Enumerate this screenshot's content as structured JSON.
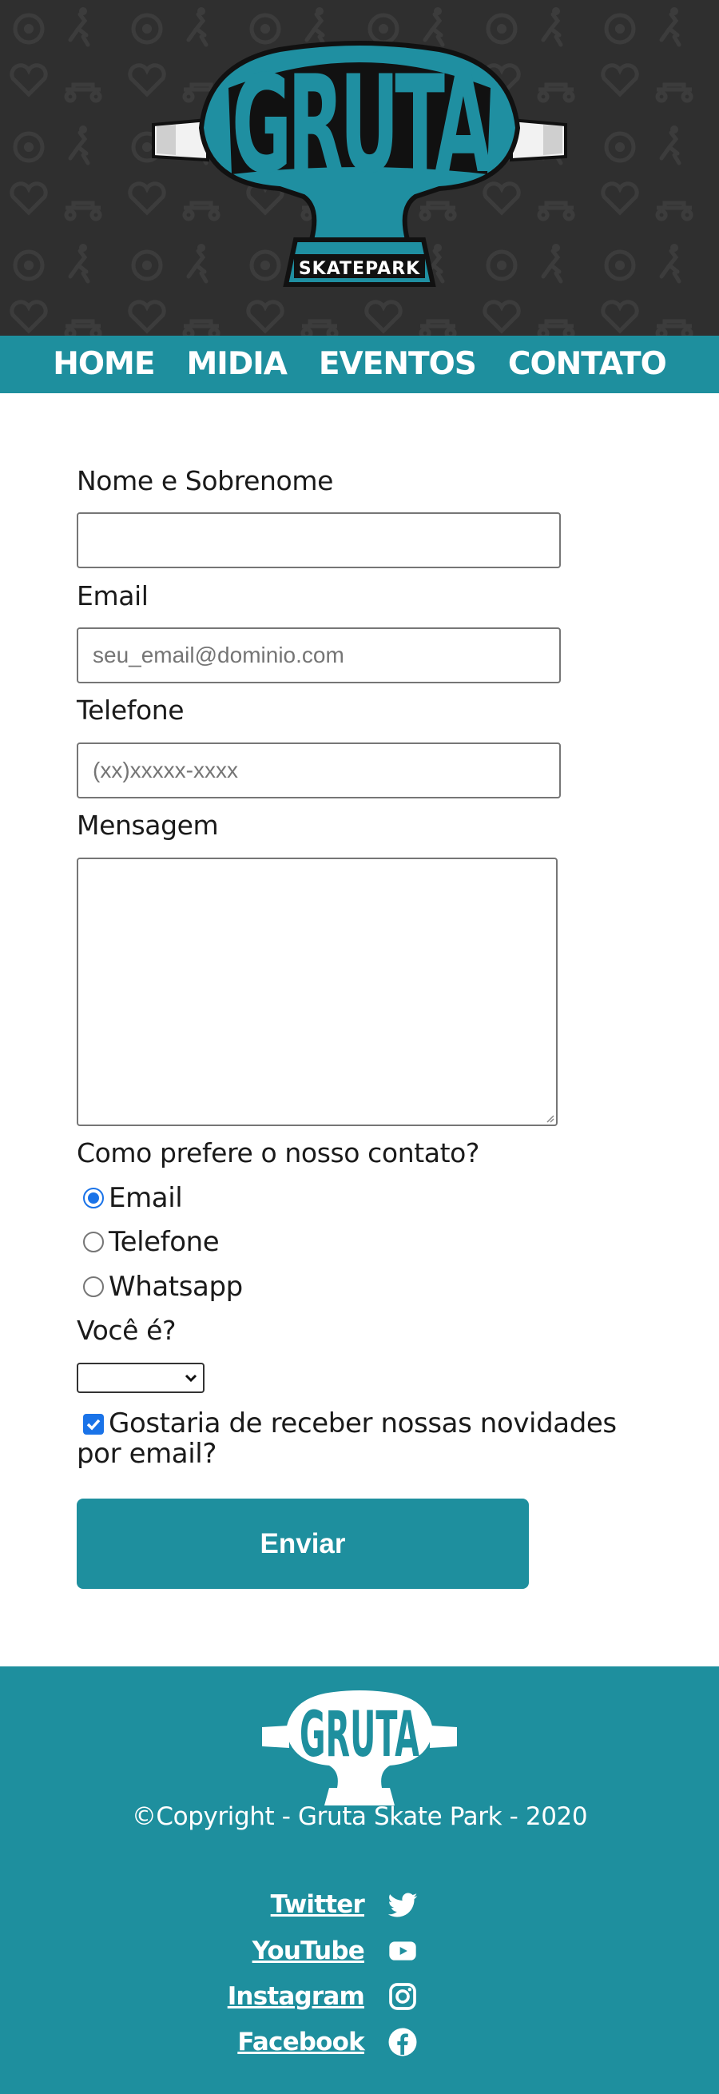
{
  "brand": {
    "logo_text": "GRUTA",
    "logo_subtext": "SKATEPARK",
    "accent_color": "#1e8f9e",
    "header_bg": "#2f2f2f"
  },
  "nav": {
    "items": [
      {
        "label": "HOME"
      },
      {
        "label": "MIDIA"
      },
      {
        "label": "EVENTOS"
      },
      {
        "label": "CONTATO"
      }
    ]
  },
  "form": {
    "name_label": "Nome e Sobrenome",
    "name_value": "",
    "email_label": "Email",
    "email_placeholder": "seu_email@dominio.com",
    "phone_label": "Telefone",
    "phone_placeholder": "(xx)xxxxx-xxxx",
    "message_label": "Mensagem",
    "message_value": "",
    "contact_pref_label": "Como prefere o nosso contato?",
    "contact_options": [
      {
        "label": "Email",
        "checked": true
      },
      {
        "label": "Telefone",
        "checked": false
      },
      {
        "label": "Whatsapp",
        "checked": false
      }
    ],
    "you_are_label": "Você é?",
    "you_are_selected": "",
    "newsletter_label": "Gostaria de receber nossas novidades por email?",
    "newsletter_checked": true,
    "submit_label": "Enviar"
  },
  "footer": {
    "copyright": "©Copyright - Gruta Skate Park - 2020",
    "social": [
      {
        "label": "Twitter",
        "icon": "twitter-icon"
      },
      {
        "label": "YouTube",
        "icon": "youtube-icon"
      },
      {
        "label": "Instagram",
        "icon": "instagram-icon"
      },
      {
        "label": "Facebook",
        "icon": "facebook-icon"
      }
    ]
  }
}
